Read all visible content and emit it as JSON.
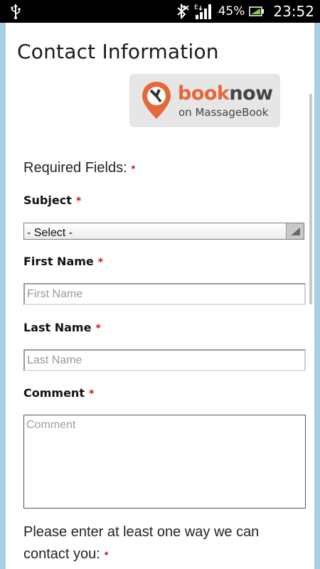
{
  "status_bar": {
    "battery_percent": "45%",
    "time": "23:52",
    "network_type": "E",
    "icons": [
      "usb-icon",
      "bluetooth-icon",
      "signal-icon",
      "battery-icon"
    ]
  },
  "page": {
    "title": "Contact Information",
    "booking_badge": {
      "brand_part1": "book",
      "brand_part2": "now",
      "tagline": "on MassageBook",
      "accent_color": "#e5673a"
    },
    "required_fields_label": "Required Fields:",
    "required_marker": "*",
    "subject": {
      "label": "Subject",
      "selected_value": "- Select -"
    },
    "first_name": {
      "label": "First Name",
      "placeholder": "First Name",
      "value": ""
    },
    "last_name": {
      "label": "Last Name",
      "placeholder": "Last Name",
      "value": ""
    },
    "comment": {
      "label": "Comment",
      "placeholder": "Comment",
      "value": ""
    },
    "contact_prompt": "Please enter at least one way we can contact you:"
  }
}
